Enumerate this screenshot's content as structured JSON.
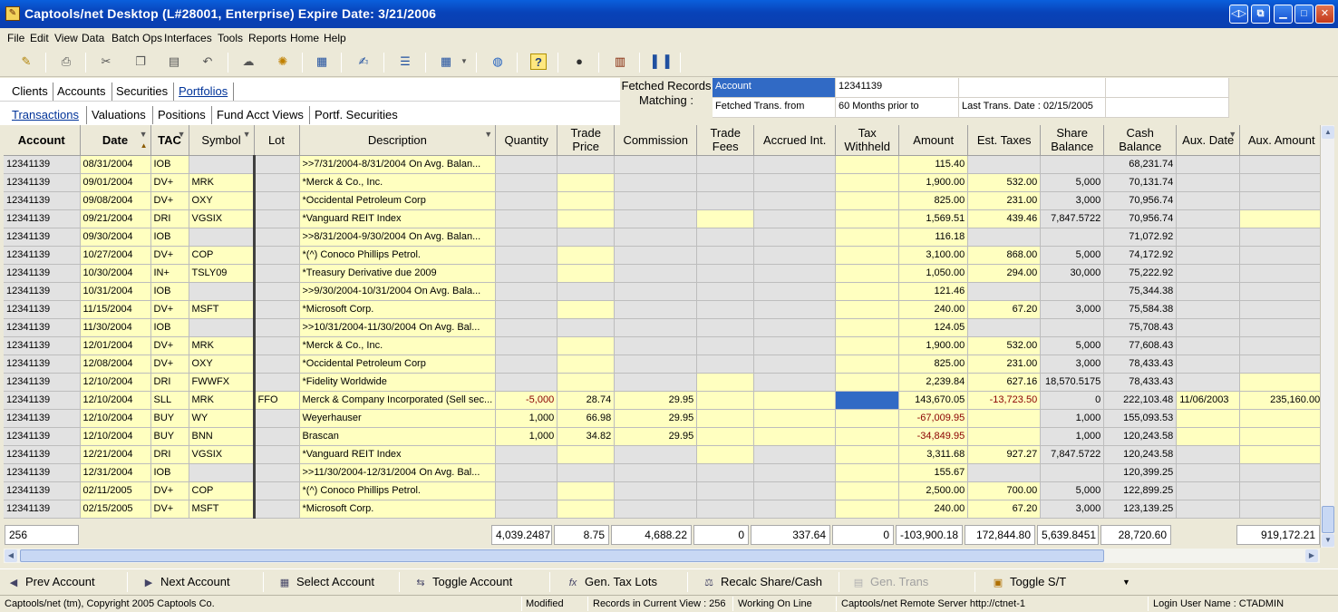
{
  "window": {
    "title": "Captools/net Desktop  (L#28001, Enterprise) Expire Date: 3/21/2006"
  },
  "menu": [
    "File",
    "Edit",
    "View",
    "Data",
    "Batch Ops",
    "Interfaces",
    "Tools",
    "Reports",
    "Home",
    "Help"
  ],
  "toolbar_icons": [
    "pencil-icon",
    "printer-icon",
    "scissors-icon",
    "copy-icon",
    "paste-icon",
    "undo-icon",
    "cloud-icon",
    "refresh-icon",
    "calculator-icon",
    "edit-form-icon",
    "form-icon",
    "table-icon",
    "globe-icon",
    "help-icon",
    "ball-icon",
    "film-icon",
    "book-icon"
  ],
  "tabs_top": [
    "Clients",
    "Accounts",
    "Securities",
    "Portfolios"
  ],
  "tabs_bottom": [
    "Transactions",
    "Valuations",
    "Positions",
    "Fund Acct Views",
    "Portf. Securities"
  ],
  "fetched": {
    "label": "Fetched Records Matching :",
    "account_label": "Account",
    "account_value": "12341139",
    "trans_label": "Fetched Trans. from",
    "trans_value": "60 Months prior to",
    "last_trans": "Last Trans. Date : 02/15/2005"
  },
  "grid": {
    "columns": [
      "Account",
      "Date",
      "TAC",
      "Symbol",
      "Lot",
      "Description",
      "Quantity",
      "Trade Price",
      "Commission",
      "Trade Fees",
      "Accrued Int.",
      "Tax Withheld",
      "Amount",
      "Est. Taxes",
      "Share Balance",
      "Cash Balance",
      "Aux. Date",
      "Aux. Amount"
    ],
    "rows": [
      [
        "12341139",
        "08/31/2004",
        "IOB",
        "",
        "",
        ">>7/31/2004-8/31/2004 On Avg. Balan...",
        "",
        "",
        "",
        "",
        "",
        "",
        "115.40",
        "",
        "",
        "68,231.74",
        "",
        ""
      ],
      [
        "12341139",
        "09/01/2004",
        "DV+",
        "MRK",
        "",
        "*Merck & Co., Inc.",
        "",
        "",
        "",
        "",
        "",
        "",
        "1,900.00",
        "532.00",
        "5,000",
        "70,131.74",
        "",
        ""
      ],
      [
        "12341139",
        "09/08/2004",
        "DV+",
        "OXY",
        "",
        "*Occidental Petroleum Corp",
        "",
        "",
        "",
        "",
        "",
        "",
        "825.00",
        "231.00",
        "3,000",
        "70,956.74",
        "",
        ""
      ],
      [
        "12341139",
        "09/21/2004",
        "DRI",
        "VGSIX",
        "",
        "*Vanguard REIT Index",
        "",
        "",
        "",
        "",
        "",
        "",
        "1,569.51",
        "439.46",
        "7,847.5722",
        "70,956.74",
        "",
        ""
      ],
      [
        "12341139",
        "09/30/2004",
        "IOB",
        "",
        "",
        ">>8/31/2004-9/30/2004 On Avg. Balan...",
        "",
        "",
        "",
        "",
        "",
        "",
        "116.18",
        "",
        "",
        "71,072.92",
        "",
        ""
      ],
      [
        "12341139",
        "10/27/2004",
        "DV+",
        "COP",
        "",
        "*(^) Conoco Phillips Petrol.",
        "",
        "",
        "",
        "",
        "",
        "",
        "3,100.00",
        "868.00",
        "5,000",
        "74,172.92",
        "",
        ""
      ],
      [
        "12341139",
        "10/30/2004",
        "IN+",
        "TSLY09",
        "",
        "*Treasury Derivative due 2009",
        "",
        "",
        "",
        "",
        "",
        "",
        "1,050.00",
        "294.00",
        "30,000",
        "75,222.92",
        "",
        ""
      ],
      [
        "12341139",
        "10/31/2004",
        "IOB",
        "",
        "",
        ">>9/30/2004-10/31/2004 On Avg. Bala...",
        "",
        "",
        "",
        "",
        "",
        "",
        "121.46",
        "",
        "",
        "75,344.38",
        "",
        ""
      ],
      [
        "12341139",
        "11/15/2004",
        "DV+",
        "MSFT",
        "",
        "*Microsoft Corp.",
        "",
        "",
        "",
        "",
        "",
        "",
        "240.00",
        "67.20",
        "3,000",
        "75,584.38",
        "",
        ""
      ],
      [
        "12341139",
        "11/30/2004",
        "IOB",
        "",
        "",
        ">>10/31/2004-11/30/2004 On Avg. Bal...",
        "",
        "",
        "",
        "",
        "",
        "",
        "124.05",
        "",
        "",
        "75,708.43",
        "",
        ""
      ],
      [
        "12341139",
        "12/01/2004",
        "DV+",
        "MRK",
        "",
        "*Merck & Co., Inc.",
        "",
        "",
        "",
        "",
        "",
        "",
        "1,900.00",
        "532.00",
        "5,000",
        "77,608.43",
        "",
        ""
      ],
      [
        "12341139",
        "12/08/2004",
        "DV+",
        "OXY",
        "",
        "*Occidental Petroleum Corp",
        "",
        "",
        "",
        "",
        "",
        "",
        "825.00",
        "231.00",
        "3,000",
        "78,433.43",
        "",
        ""
      ],
      [
        "12341139",
        "12/10/2004",
        "DRI",
        "FWWFX",
        "",
        "*Fidelity Worldwide",
        "",
        "",
        "",
        "",
        "",
        "",
        "2,239.84",
        "627.16",
        "18,570.5175",
        "78,433.43",
        "",
        ""
      ],
      [
        "12341139",
        "12/10/2004",
        "SLL",
        "MRK",
        "FFO",
        "Merck & Company Incorporated (Sell sec...",
        "-5,000",
        "28.74",
        "29.95",
        "",
        "",
        "",
        "143,670.05",
        "-13,723.50",
        "0",
        "222,103.48",
        "11/06/2003",
        "235,160.00"
      ],
      [
        "12341139",
        "12/10/2004",
        "BUY",
        "WY",
        "",
        "Weyerhauser",
        "1,000",
        "66.98",
        "29.95",
        "",
        "",
        "",
        "-67,009.95",
        "",
        "1,000",
        "155,093.53",
        "",
        ""
      ],
      [
        "12341139",
        "12/10/2004",
        "BUY",
        "BNN",
        "",
        "Brascan",
        "1,000",
        "34.82",
        "29.95",
        "",
        "",
        "",
        "-34,849.95",
        "",
        "1,000",
        "120,243.58",
        "",
        ""
      ],
      [
        "12341139",
        "12/21/2004",
        "DRI",
        "VGSIX",
        "",
        "*Vanguard REIT Index",
        "",
        "",
        "",
        "",
        "",
        "",
        "3,311.68",
        "927.27",
        "7,847.5722",
        "120,243.58",
        "",
        ""
      ],
      [
        "12341139",
        "12/31/2004",
        "IOB",
        "",
        "",
        ">>11/30/2004-12/31/2004 On Avg. Bal...",
        "",
        "",
        "",
        "",
        "",
        "",
        "155.67",
        "",
        "",
        "120,399.25",
        "",
        ""
      ],
      [
        "12341139",
        "02/11/2005",
        "DV+",
        "COP",
        "",
        "*(^) Conoco Phillips Petrol.",
        "",
        "",
        "",
        "",
        "",
        "",
        "2,500.00",
        "700.00",
        "5,000",
        "122,899.25",
        "",
        ""
      ],
      [
        "12341139",
        "02/15/2005",
        "DV+",
        "MSFT",
        "",
        "*Microsoft Corp.",
        "",
        "",
        "",
        "",
        "",
        "",
        "240.00",
        "67.20",
        "3,000",
        "123,139.25",
        "",
        ""
      ]
    ]
  },
  "totals": {
    "count": "256",
    "quantity": "4,039.2487",
    "trade_price": "8.75",
    "commission": "4,688.22",
    "trade_fees": "0",
    "accrued": "337.64",
    "tax_withheld": "0",
    "amount": "-103,900.18",
    "est_taxes": "172,844.80",
    "share_balance": "5,639.8451",
    "cash_balance": "28,720.60",
    "aux_amount": "919,172.21"
  },
  "actions": [
    "Prev Account",
    "Next Account",
    "Select Account",
    "Toggle Account",
    "Gen. Tax Lots",
    "Recalc Share/Cash",
    "Gen. Trans",
    "Toggle S/T"
  ],
  "status": {
    "copyright": "Captools/net (tm), Copyright 2005 Captools Co.",
    "modified": "Modified",
    "records": "Records in Current View : 256",
    "online": "Working On Line",
    "server": "Captools/net Remote Server http://ctnet-1",
    "login": "Login User Name : CTADMIN"
  }
}
